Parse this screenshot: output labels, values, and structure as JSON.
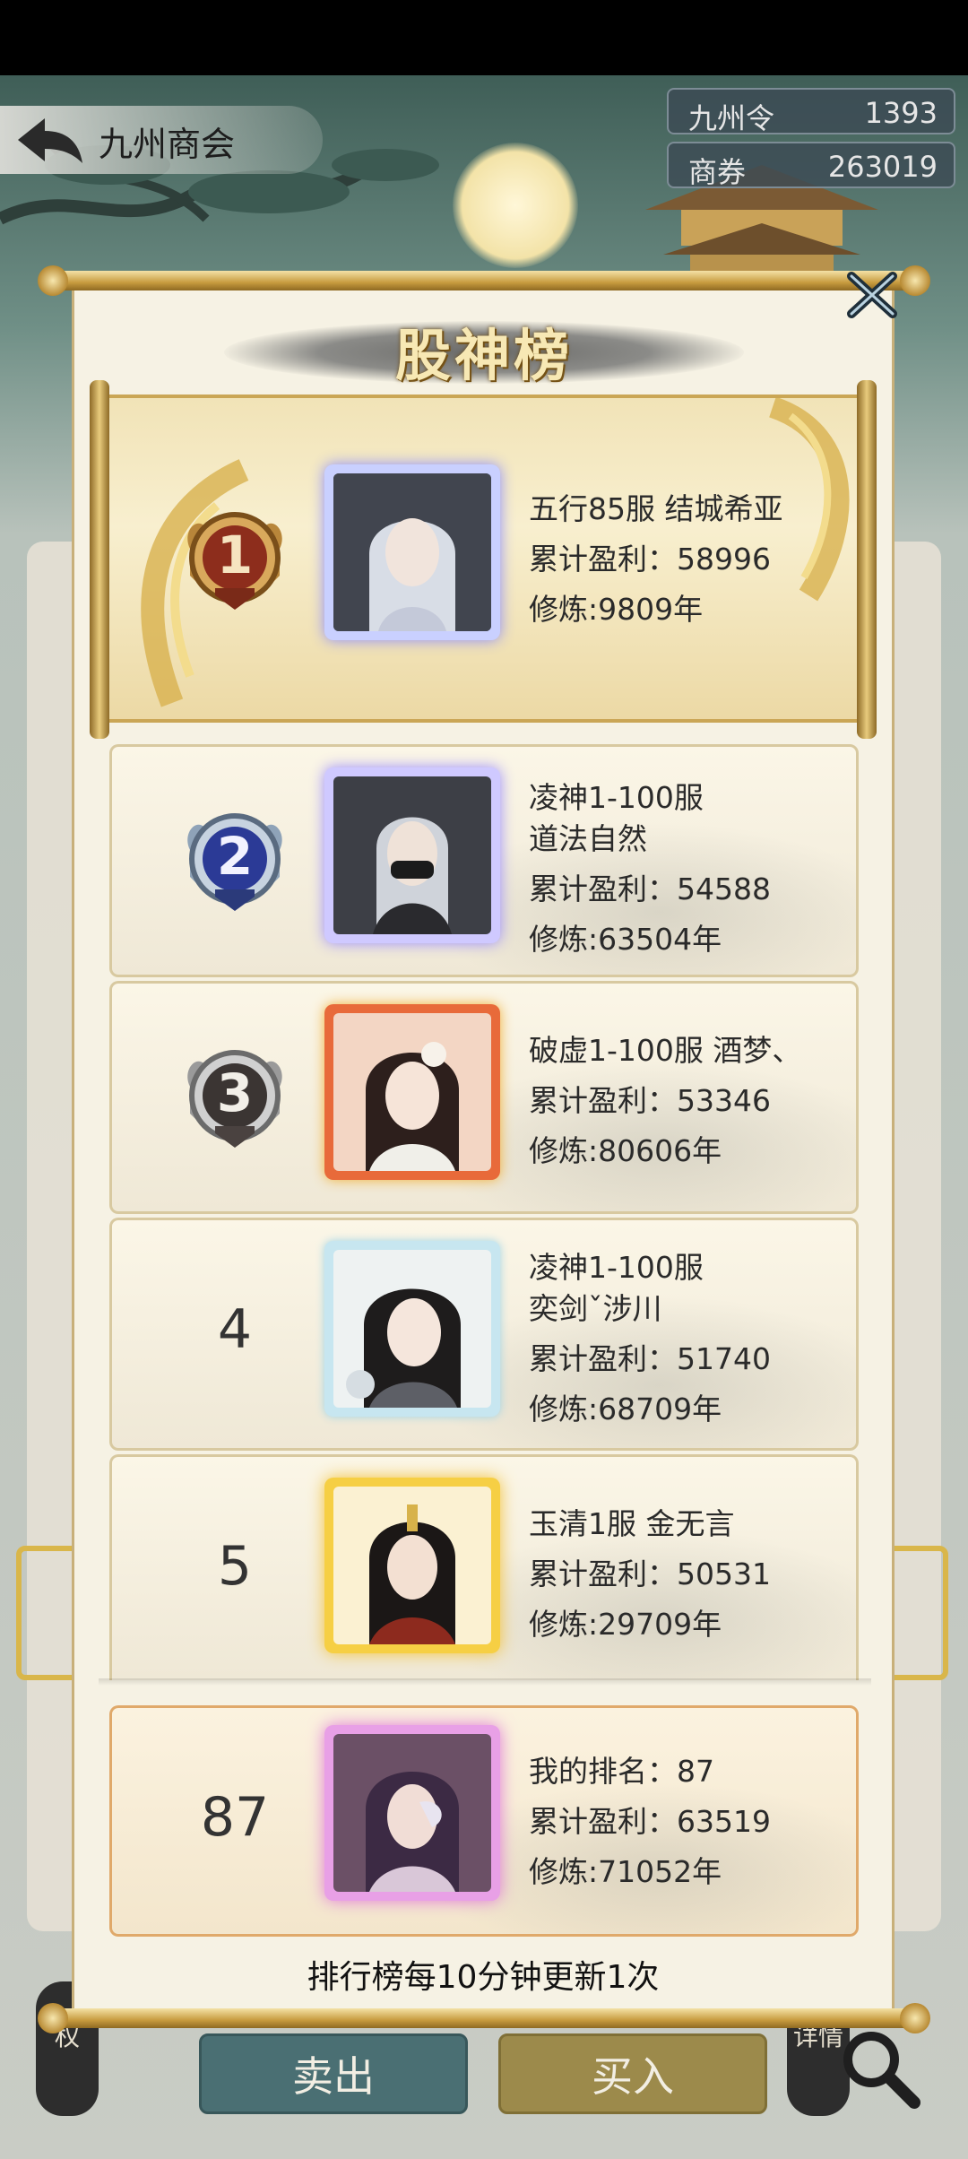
{
  "nav": {
    "title": "九州商会"
  },
  "currencies": [
    {
      "label": "九州令",
      "value": "1393"
    },
    {
      "label": "商券",
      "value": "263019"
    }
  ],
  "modal": {
    "title": "股神榜",
    "footer": "排行榜每10分钟更新1次"
  },
  "ranking": [
    {
      "rank": "1",
      "name_line1": "五行85服 结城希亚",
      "name_line2": "",
      "profit": "累计盈利：58996",
      "cultivation": "修炼:9809年",
      "frame": "#9ea7ff"
    },
    {
      "rank": "2",
      "name_line1": "凌神1-100服",
      "name_line2": "道法自然",
      "profit": "累计盈利：54588",
      "cultivation": "修炼:63504年",
      "frame": "#a7a2ff"
    },
    {
      "rank": "3",
      "name_line1": "破虚1-100服 酒梦、",
      "name_line2": "",
      "profit": "累计盈利：53346",
      "cultivation": "修炼:80606年",
      "frame": "#e05a3a"
    },
    {
      "rank": "4",
      "name_line1": "凌神1-100服",
      "name_line2": "奕剑ˇ涉川",
      "profit": "累计盈利：51740",
      "cultivation": "修炼:68709年",
      "frame": "#9fd4e6"
    },
    {
      "rank": "5",
      "name_line1": "玉清1服 金无言",
      "name_line2": "",
      "profit": "累计盈利：50531",
      "cultivation": "修炼:29709年",
      "frame": "#f2c23a"
    }
  ],
  "me": {
    "rank": "87",
    "rank_line": "我的排名：87",
    "profit": "累计盈利：63519",
    "cultivation": "修炼:71052年",
    "frame": "#e07ad8"
  },
  "buttons": {
    "sell": "卖出",
    "buy": "买入"
  },
  "side_tabs": {
    "left": "权",
    "right": "详情"
  }
}
